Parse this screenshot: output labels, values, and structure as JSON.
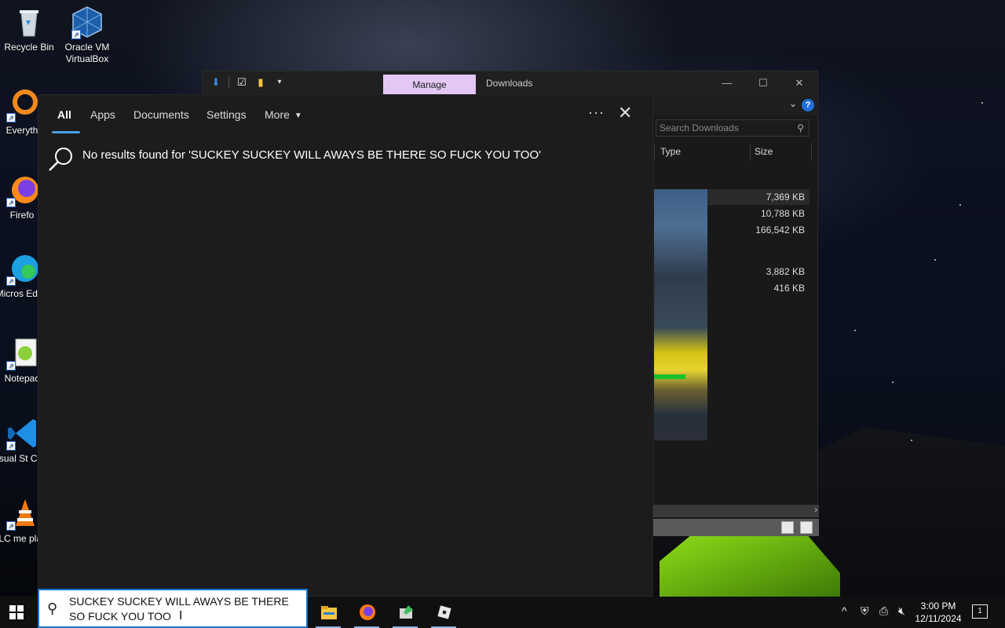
{
  "desktop": {
    "icons": [
      {
        "label": "Recycle Bin",
        "icon": "recycle-bin-icon"
      },
      {
        "label": "Oracle VM VirtualBox",
        "icon": "virtualbox-icon"
      },
      {
        "label": "Everyth",
        "icon": "everything-search-icon"
      },
      {
        "label": "Firefo",
        "icon": "firefox-icon"
      },
      {
        "label": "Micros Edge",
        "icon": "edge-icon"
      },
      {
        "label": "Notepac",
        "icon": "notepad-plus-icon"
      },
      {
        "label": "Visual St Code",
        "icon": "vscode-icon"
      },
      {
        "label": "VLC me playe",
        "icon": "vlc-icon"
      }
    ]
  },
  "explorer": {
    "manage_tab": "Manage",
    "title": "Downloads",
    "search_placeholder": "Search Downloads",
    "columns": {
      "type": "Type",
      "size": "Size"
    },
    "sizes": [
      "7,369 KB",
      "10,788 KB",
      "166,542 KB",
      "3,882 KB",
      "416 KB"
    ]
  },
  "search_panel": {
    "tabs": [
      "All",
      "Apps",
      "Documents",
      "Settings",
      "More"
    ],
    "active_tab": "All",
    "no_results": "No results found for 'SUCKEY SUCKEY WILL AWAYS BE THERE SO FUCK YOU TOO'"
  },
  "taskbar": {
    "search_text": "SUCKEY SUCKEY WILL AWAYS BE THERE SO FUCK YOU TOO",
    "apps": [
      "file-explorer-icon",
      "firefox-icon",
      "notepad-plus-icon",
      "roblox-icon"
    ],
    "time": "3:00 PM",
    "date": "12/11/2024",
    "notification_count": "1"
  }
}
